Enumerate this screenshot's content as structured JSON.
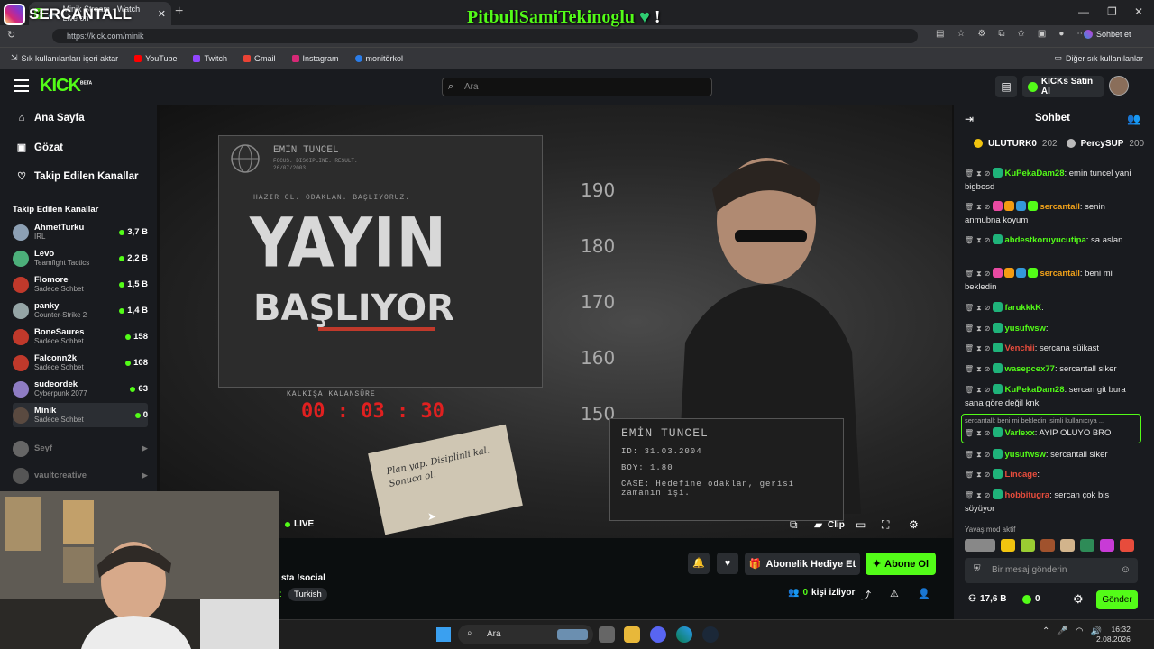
{
  "browser": {
    "tab_title": "Minik Stream - Watch Live on",
    "url": "https://kick.com/minik",
    "copilot_label": "Sohbet et",
    "bookmarks": [
      "Sık kullanılanları içeri aktar",
      "YouTube",
      "Twitch",
      "Gmail",
      "Instagram",
      "monitörkol"
    ],
    "other_bookmarks": "Diğer sık kullanılanlar"
  },
  "overlay": {
    "instagram_handle": "SERCANTALL",
    "banner_text": "PitbullSamiTekinoglu",
    "banner_suffix": "!"
  },
  "header": {
    "logo": "KICK",
    "logo_badge": "BETA",
    "search_placeholder": "Ara",
    "kicks_button": "KICKs Satın Al"
  },
  "sidebar": {
    "nav": [
      {
        "label": "Ana Sayfa",
        "icon": "home-icon"
      },
      {
        "label": "Gözat",
        "icon": "browse-icon"
      },
      {
        "label": "Takip Edilen Kanallar",
        "icon": "heart-icon"
      }
    ],
    "section_title": "Takip Edilen Kanallar",
    "channels": [
      {
        "name": "AhmetTurku",
        "category": "IRL",
        "viewers": "3,7 B",
        "color": "#8ca0b4"
      },
      {
        "name": "Levo",
        "category": "Teamfight Tactics",
        "viewers": "2,2 B",
        "color": "#4caf7a"
      },
      {
        "name": "Flomore",
        "category": "Sadece Sohbet",
        "viewers": "1,5 B",
        "color": "#c0392b"
      },
      {
        "name": "panky",
        "category": "Counter-Strike 2",
        "viewers": "1,4 B",
        "color": "#95a5a6"
      },
      {
        "name": "BoneSaures",
        "category": "Sadece Sohbet",
        "viewers": "158",
        "color": "#c0392b"
      },
      {
        "name": "Falconn2k",
        "category": "Sadece Sohbet",
        "viewers": "108",
        "color": "#c0392b"
      },
      {
        "name": "sudeordek",
        "category": "Cyberpunk 2077",
        "viewers": "63",
        "color": "#8e7cc3"
      },
      {
        "name": "Minik",
        "category": "Sadece Sohbet",
        "viewers": "0",
        "color": "#5a4a40"
      }
    ],
    "offline_channels": [
      {
        "name": "Seyf",
        "color": "#666"
      },
      {
        "name": "vaultcreative",
        "color": "#555"
      }
    ]
  },
  "stream": {
    "poster": {
      "header": "EMİN TUNCEL",
      "sub1": "FOCUS. DISCIPLINE. RESULT.",
      "sub2": "26/07/2003",
      "tagline": "HAZIR OL.   ODAKLAN.   BAŞLIYORUZ.",
      "title1": "YAYIN",
      "title2": "BAŞLIYOR",
      "countdown_label": "KALKIŞA KALANSÜRE",
      "countdown": "00 : 03 : 30",
      "scale": [
        "190",
        "180",
        "170",
        "160",
        "150"
      ],
      "id_name": "EMİN TUNCEL",
      "id_lines": [
        "ID: 31.03.2004",
        "BOY: 1.80",
        "CASE: Hedefine odaklan, gerisi zamanın işi."
      ],
      "note": "Plan yap. Disiplinli kal. Sonuca ol."
    },
    "live_label": "LIVE",
    "clip_label": "Clip",
    "title_partial": "sta !social",
    "language": "Turkish",
    "viewers_count": "0",
    "viewers_label": "kişi izliyor",
    "gift_button": "Abonelik Hediye Et",
    "subscribe_button": "Abone Ol"
  },
  "chat": {
    "title": "Sohbet",
    "pinned": [
      {
        "user": "ULUTURK0",
        "count": "202",
        "color": "#f1c40f"
      },
      {
        "user": "PercySUP",
        "count": "200",
        "color": "#bbbbbb"
      }
    ],
    "messages": [
      {
        "user": "KuPekaDam28",
        "color": "#53fc18",
        "text": ": emin tuncel yani bigbosd"
      },
      {
        "user": "sercantall",
        "color": "#f1a21a",
        "text": ": senin anmubna koyum"
      },
      {
        "user": "abdestkoruyucutipa",
        "color": "#53fc18",
        "text": ": sa aslan"
      },
      {
        "user": "sercantall",
        "color": "#f1a21a",
        "text": ": beni mi bekledin"
      },
      {
        "user": "farukkkK",
        "color": "#53fc18",
        "text": ":"
      },
      {
        "user": "yusufwsw",
        "color": "#53fc18",
        "text": ":"
      },
      {
        "user": "Venchii",
        "color": "#e74c3c",
        "text": ": sercana süikast"
      },
      {
        "user": "wasepcex77",
        "color": "#53fc18",
        "text": ": sercantall siker"
      },
      {
        "user": "KuPekaDam28",
        "color": "#53fc18",
        "text": ": sercan git bura sana göre değil knk"
      },
      {
        "user": "Varlexx",
        "color": "#53fc18",
        "text": ": AYIP OLUYO BRO"
      },
      {
        "user": "yusufwsw",
        "color": "#53fc18",
        "text": ": sercantall siker"
      },
      {
        "user": "Lincage",
        "color": "#e74c3c",
        "text": ":"
      },
      {
        "user": "hobbitugra",
        "color": "#e74c3c",
        "text": ": sercan çok bis söyüyor"
      }
    ],
    "reply_hint": "sercantall: beni mi bekledin isimli kullanıcıya ...",
    "slow_mode": "Yavaş mod aktif",
    "input_placeholder": "Bir mesaj gönderin",
    "followers": "17,6 B",
    "kicks": "0",
    "send_button": "Gönder"
  },
  "taskbar": {
    "search_placeholder": "Ara",
    "time": "16:32",
    "date": "2.08.2026"
  }
}
